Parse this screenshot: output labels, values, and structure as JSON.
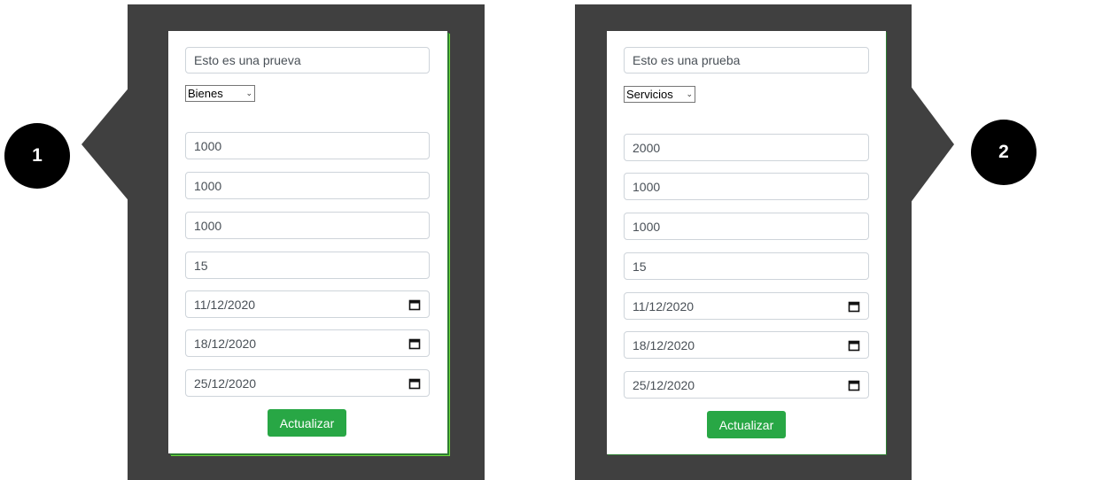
{
  "left_panel": {
    "step": "1",
    "description": "Esto es una prueva",
    "category": "Bienes",
    "amount1": "1000",
    "amount2": "1000",
    "amount3": "1000",
    "percent": "15",
    "date1": "11/12/2020",
    "date2": "18/12/2020",
    "date3": "25/12/2020",
    "button": "Actualizar"
  },
  "right_panel": {
    "step": "2",
    "description": "Esto es una prueba",
    "category": "Servicios",
    "amount1": "2000",
    "amount2": "1000",
    "amount3": "1000",
    "percent": "15",
    "date1": "11/12/2020",
    "date2": "18/12/2020",
    "date3": "25/12/2020",
    "button": "Actualizar"
  },
  "icons": {
    "date_picker": "calendar-icon",
    "dropdown": "chevron-down-icon"
  },
  "colors": {
    "frame": "#404040",
    "button": "#28a745",
    "badge": "#000000"
  }
}
